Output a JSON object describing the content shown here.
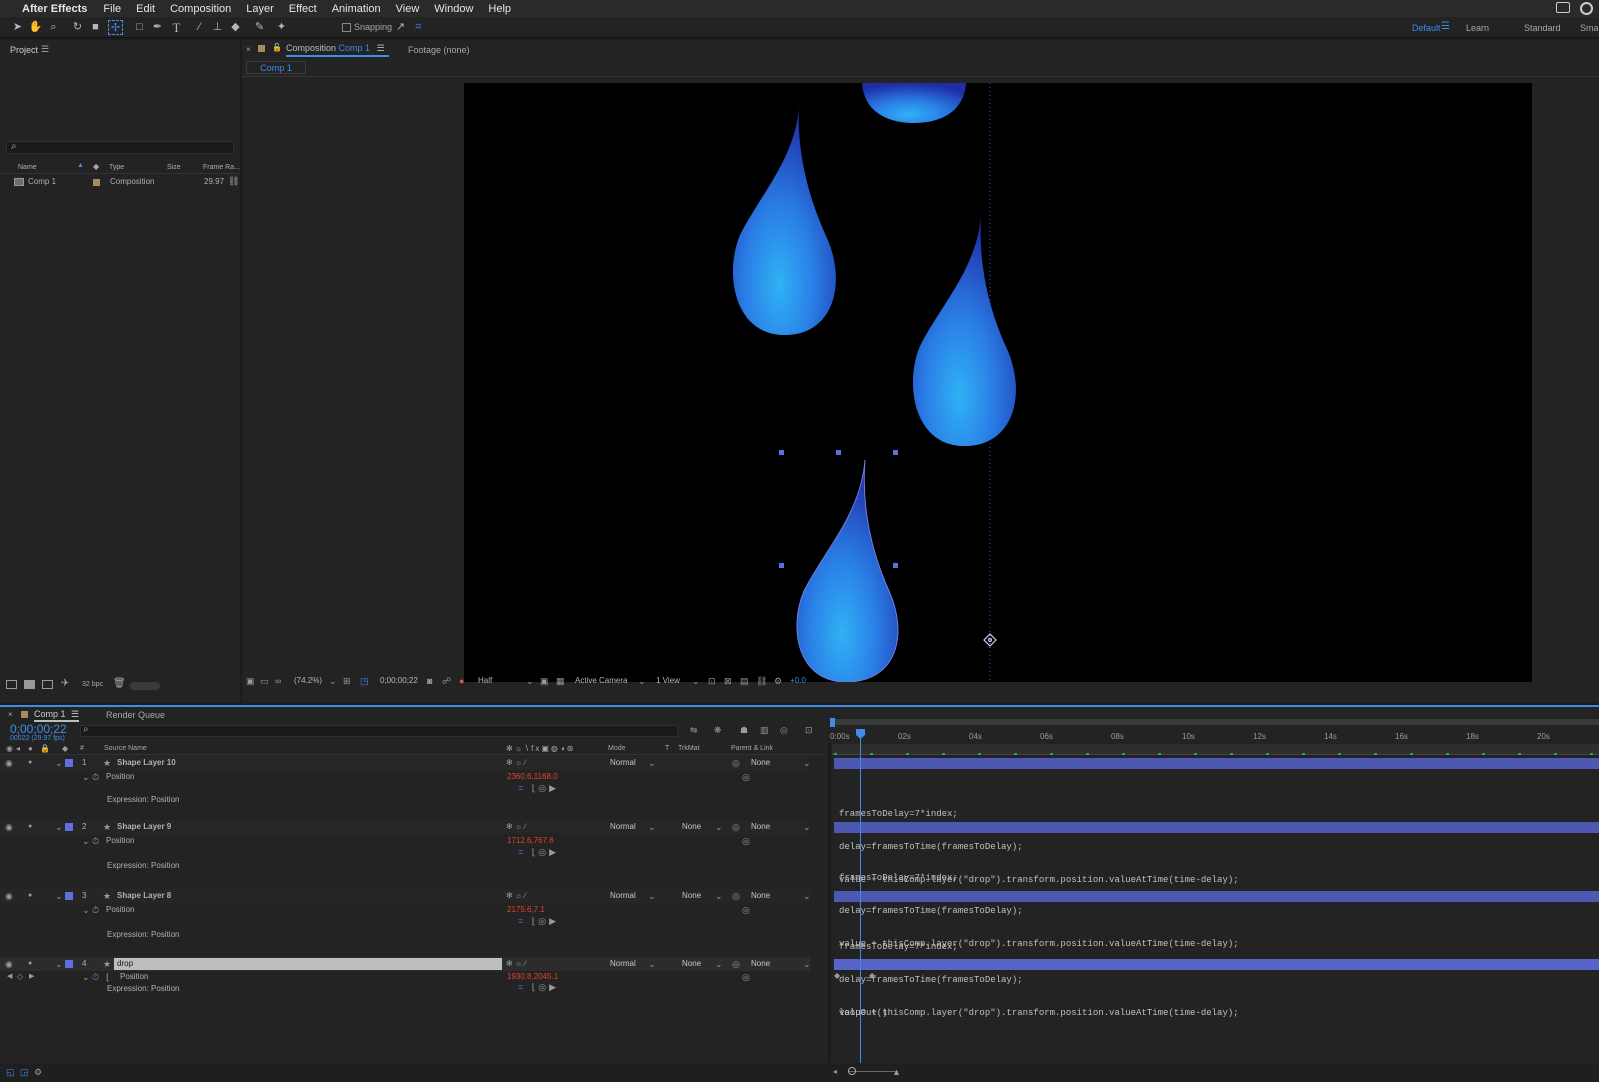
{
  "menubar": {
    "app": "After Effects",
    "items": [
      "File",
      "Edit",
      "Composition",
      "Layer",
      "Effect",
      "Animation",
      "View",
      "Window",
      "Help"
    ]
  },
  "toolbar": {
    "snapping": "Snapping",
    "workspaces": [
      "Default",
      "Learn",
      "Standard",
      "Sma"
    ]
  },
  "project": {
    "title": "Project",
    "columns": {
      "name": "Name",
      "type": "Type",
      "size": "Size",
      "frame_rate": "Frame Ra..."
    },
    "items": [
      {
        "name": "Comp 1",
        "type": "Composition",
        "frame_rate": "29.97"
      }
    ],
    "bpc": "32 bpc"
  },
  "viewer": {
    "tab_prefix": "Composition",
    "tab_comp": "Comp 1",
    "footage_tab": "Footage (none)",
    "breadcrumb": "Comp 1",
    "zoom": "(74.2%)",
    "time": "0;00;00;22",
    "resolution": "Half",
    "camera": "Active Camera",
    "views": "1 View",
    "exposure": "+0.0"
  },
  "timeline": {
    "tab": "Comp 1",
    "render_queue": "Render Queue",
    "timecode": "0;00;00;22",
    "fps": "00022 (29.97 fps)",
    "headers": {
      "source_name": "Source Name",
      "mode": "Mode",
      "t": "T",
      "trkmat": "TrkMat",
      "parent": "Parent & Link",
      "num": "#"
    },
    "ruler": [
      "0:00s",
      "02s",
      "04s",
      "06s",
      "08s",
      "10s",
      "12s",
      "14s",
      "16s",
      "18s",
      "20s"
    ],
    "layers": [
      {
        "num": "1",
        "name": "Shape Layer 10",
        "mode": "Normal",
        "trkmat": "",
        "parent": "None",
        "prop": "Position",
        "value": "2360.6,1168.0",
        "expr_label": "Expression: Position",
        "expr": [
          "framesToDelay=7*index;",
          "delay=framesToTime(framesToDelay);",
          "value + thisComp.layer(\"drop\").transform.position.valueAtTime(time-delay);"
        ]
      },
      {
        "num": "2",
        "name": "Shape Layer 9",
        "mode": "Normal",
        "trkmat": "None",
        "parent": "None",
        "prop": "Position",
        "value": "1712.6,767.6",
        "expr_label": "Expression: Position",
        "expr": [
          "framesToDelay=7*index;",
          "delay=framesToTime(framesToDelay);",
          "value + thisComp.layer(\"drop\").transform.position.valueAtTime(time-delay);"
        ]
      },
      {
        "num": "3",
        "name": "Shape Layer 8",
        "mode": "Normal",
        "trkmat": "None",
        "parent": "None",
        "prop": "Position",
        "value": "2175.6,7.1",
        "expr_label": "Expression: Position",
        "expr": [
          "framesToDelay=7*index;",
          "delay=framesToTime(framesToDelay);",
          "value + thisComp.layer(\"drop\").transform.position.valueAtTime(time-delay);"
        ]
      },
      {
        "num": "4",
        "name": "drop",
        "mode": "Normal",
        "trkmat": "None",
        "parent": "None",
        "prop": "Position",
        "value": "1930.8,2045.1",
        "expr_label": "Expression: Position",
        "expr": [
          "loopOut()"
        ]
      }
    ]
  }
}
